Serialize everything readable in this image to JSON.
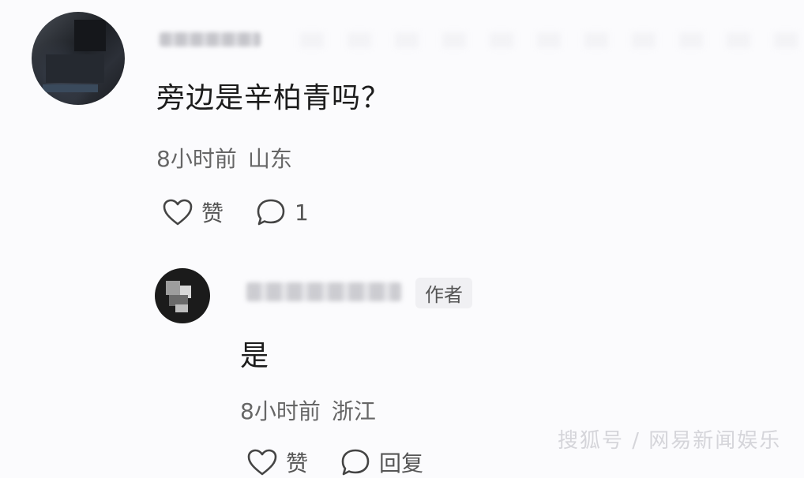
{
  "main_comment": {
    "username": "",
    "text": "旁边是辛柏青吗？",
    "time": "8小时前",
    "location": "山东",
    "like_label": "赞",
    "reply_count": "1"
  },
  "reply": {
    "username": "",
    "author_tag": "作者",
    "text": "是",
    "time": "8小时前",
    "location": "浙江",
    "like_label": "赞",
    "reply_label": "回复"
  },
  "watermark": "搜狐号 / 网易新闻娱乐",
  "colors": {
    "background": "#fbfbfd",
    "text": "#1c1c1c",
    "meta_text": "#666666"
  },
  "icons": [
    "heart-icon",
    "comment-bubble-icon"
  ]
}
